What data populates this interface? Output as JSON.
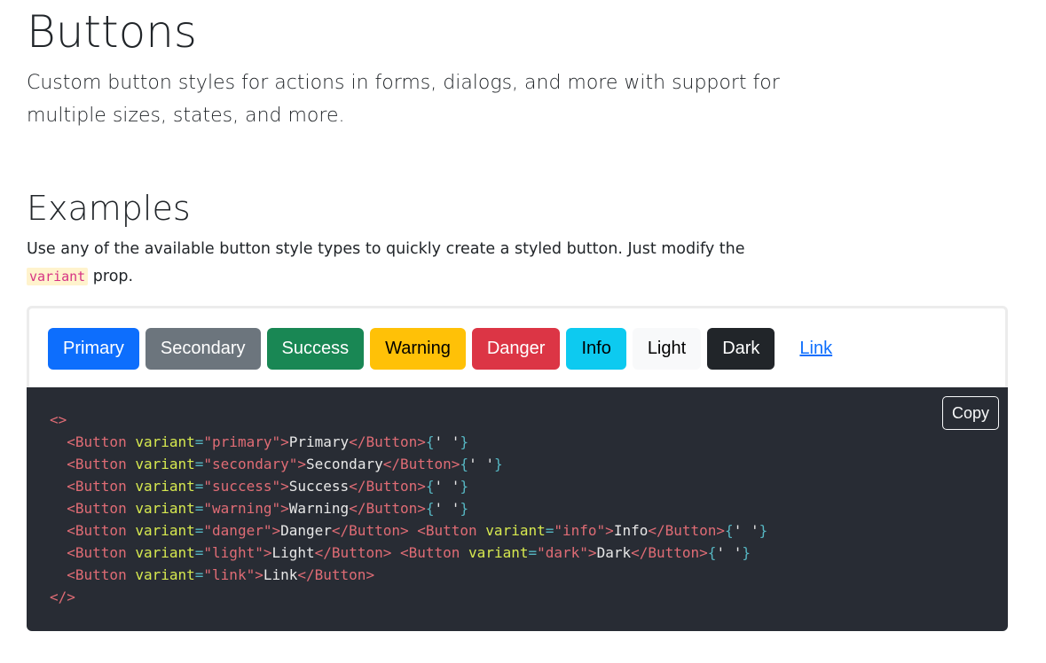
{
  "header": {
    "title": "Buttons",
    "lead": "Custom button styles for actions in forms, dialogs, and more with support for multiple sizes, states, and more."
  },
  "examples": {
    "title": "Examples",
    "description_before": "Use any of the available button style types to quickly create a styled button. Just modify the",
    "description_code": "variant",
    "description_after": "prop."
  },
  "buttons": [
    {
      "label": "Primary",
      "variant": "primary"
    },
    {
      "label": "Secondary",
      "variant": "secondary"
    },
    {
      "label": "Success",
      "variant": "success"
    },
    {
      "label": "Warning",
      "variant": "warning"
    },
    {
      "label": "Danger",
      "variant": "danger"
    },
    {
      "label": "Info",
      "variant": "info"
    },
    {
      "label": "Light",
      "variant": "light"
    },
    {
      "label": "Dark",
      "variant": "dark"
    },
    {
      "label": "Link",
      "variant": "link"
    }
  ],
  "code_block": {
    "copy_label": "Copy",
    "lines": [
      [
        {
          "t": "punc",
          "v": "<>"
        }
      ],
      [
        {
          "t": "tag",
          "v": "  <Button "
        },
        {
          "t": "attr",
          "v": "variant"
        },
        {
          "t": "eq",
          "v": "="
        },
        {
          "t": "str",
          "v": "\"primary\""
        },
        {
          "t": "tag",
          "v": ">"
        },
        {
          "t": "text",
          "v": "Primary"
        },
        {
          "t": "tag",
          "v": "</Button>"
        },
        {
          "t": "br",
          "v": "{"
        },
        {
          "t": "q",
          "v": "' '"
        },
        {
          "t": "br",
          "v": "}"
        }
      ],
      [
        {
          "t": "tag",
          "v": "  <Button "
        },
        {
          "t": "attr",
          "v": "variant"
        },
        {
          "t": "eq",
          "v": "="
        },
        {
          "t": "str",
          "v": "\"secondary\""
        },
        {
          "t": "tag",
          "v": ">"
        },
        {
          "t": "text",
          "v": "Secondary"
        },
        {
          "t": "tag",
          "v": "</Button>"
        },
        {
          "t": "br",
          "v": "{"
        },
        {
          "t": "q",
          "v": "' '"
        },
        {
          "t": "br",
          "v": "}"
        }
      ],
      [
        {
          "t": "tag",
          "v": "  <Button "
        },
        {
          "t": "attr",
          "v": "variant"
        },
        {
          "t": "eq",
          "v": "="
        },
        {
          "t": "str",
          "v": "\"success\""
        },
        {
          "t": "tag",
          "v": ">"
        },
        {
          "t": "text",
          "v": "Success"
        },
        {
          "t": "tag",
          "v": "</Button>"
        },
        {
          "t": "br",
          "v": "{"
        },
        {
          "t": "q",
          "v": "' '"
        },
        {
          "t": "br",
          "v": "}"
        }
      ],
      [
        {
          "t": "tag",
          "v": "  <Button "
        },
        {
          "t": "attr",
          "v": "variant"
        },
        {
          "t": "eq",
          "v": "="
        },
        {
          "t": "str",
          "v": "\"warning\""
        },
        {
          "t": "tag",
          "v": ">"
        },
        {
          "t": "text",
          "v": "Warning"
        },
        {
          "t": "tag",
          "v": "</Button>"
        },
        {
          "t": "br",
          "v": "{"
        },
        {
          "t": "q",
          "v": "' '"
        },
        {
          "t": "br",
          "v": "}"
        }
      ],
      [
        {
          "t": "tag",
          "v": "  <Button "
        },
        {
          "t": "attr",
          "v": "variant"
        },
        {
          "t": "eq",
          "v": "="
        },
        {
          "t": "str",
          "v": "\"danger\""
        },
        {
          "t": "tag",
          "v": ">"
        },
        {
          "t": "text",
          "v": "Danger"
        },
        {
          "t": "tag",
          "v": "</Button> <Button "
        },
        {
          "t": "attr",
          "v": "variant"
        },
        {
          "t": "eq",
          "v": "="
        },
        {
          "t": "str",
          "v": "\"info\""
        },
        {
          "t": "tag",
          "v": ">"
        },
        {
          "t": "text",
          "v": "Info"
        },
        {
          "t": "tag",
          "v": "</Button>"
        },
        {
          "t": "br",
          "v": "{"
        },
        {
          "t": "q",
          "v": "' '"
        },
        {
          "t": "br",
          "v": "}"
        }
      ],
      [
        {
          "t": "tag",
          "v": "  <Button "
        },
        {
          "t": "attr",
          "v": "variant"
        },
        {
          "t": "eq",
          "v": "="
        },
        {
          "t": "str",
          "v": "\"light\""
        },
        {
          "t": "tag",
          "v": ">"
        },
        {
          "t": "text",
          "v": "Light"
        },
        {
          "t": "tag",
          "v": "</Button> <Button "
        },
        {
          "t": "attr",
          "v": "variant"
        },
        {
          "t": "eq",
          "v": "="
        },
        {
          "t": "str",
          "v": "\"dark\""
        },
        {
          "t": "tag",
          "v": ">"
        },
        {
          "t": "text",
          "v": "Dark"
        },
        {
          "t": "tag",
          "v": "</Button>"
        },
        {
          "t": "br",
          "v": "{"
        },
        {
          "t": "q",
          "v": "' '"
        },
        {
          "t": "br",
          "v": "}"
        }
      ],
      [
        {
          "t": "tag",
          "v": "  <Button "
        },
        {
          "t": "attr",
          "v": "variant"
        },
        {
          "t": "eq",
          "v": "="
        },
        {
          "t": "str",
          "v": "\"link\""
        },
        {
          "t": "tag",
          "v": ">"
        },
        {
          "t": "text",
          "v": "Link"
        },
        {
          "t": "tag",
          "v": "</Button>"
        }
      ],
      [
        {
          "t": "punc",
          "v": "</>"
        }
      ]
    ]
  },
  "colors": {
    "primary": "#0d6efd",
    "secondary": "#6c757d",
    "success": "#198754",
    "warning": "#ffc107",
    "danger": "#dc3545",
    "info": "#0dcaf0",
    "light": "#f8f9fa",
    "dark": "#212529",
    "code_background": "#282c34"
  }
}
